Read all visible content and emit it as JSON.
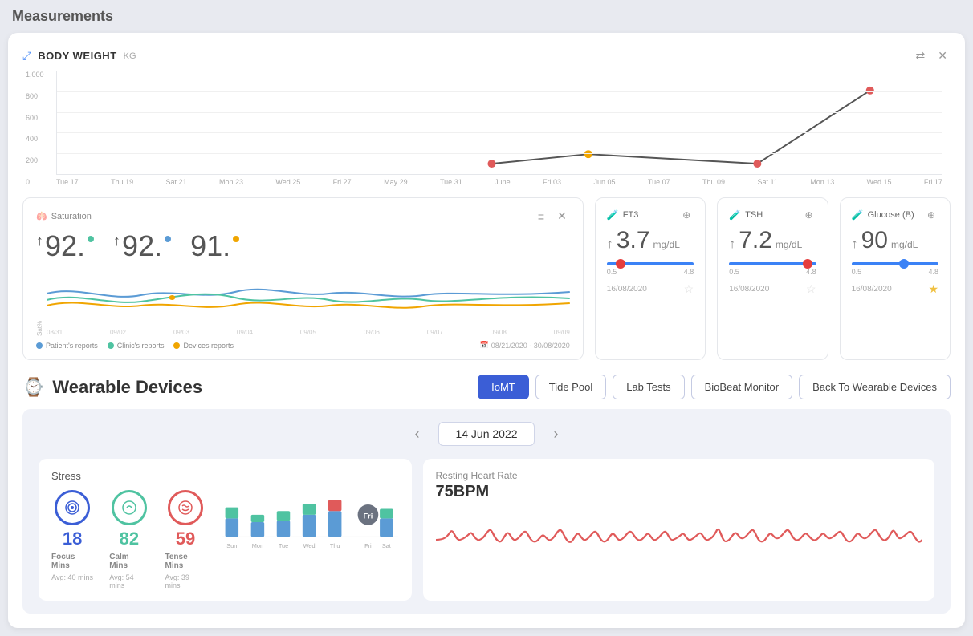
{
  "page": {
    "title": "Measurements"
  },
  "bodyWeight": {
    "title": "BODY WEIGHT",
    "unit": "KG",
    "yLabels": [
      "1,000",
      "800",
      "600",
      "400",
      "200",
      "0"
    ],
    "xLabels": [
      "Tue 17",
      "Thu 19",
      "Sat 21",
      "Mon 23",
      "Wed 25",
      "Fri 27",
      "May 29",
      "Tue 31",
      "June",
      "Fri 03",
      "Jun 05",
      "Tue 07",
      "Thu 09",
      "Sat 11",
      "Mon 13",
      "Wed 15",
      "Fri 17"
    ]
  },
  "saturation": {
    "title": "Saturation",
    "yLabel": "Sat%",
    "values": [
      "92.",
      "92.",
      "91."
    ],
    "xLabels": [
      "08/31",
      "09/02",
      "09/03",
      "09/04",
      "09/05",
      "09/06",
      "09/07",
      "09/08",
      "09/09"
    ],
    "dateRange": "08/21/2020 - 30/08/2020",
    "legend": [
      {
        "label": "Patient's reports",
        "color": "#5b9bd5"
      },
      {
        "label": "Clinic's reports",
        "color": "#4fc3a1"
      },
      {
        "label": "Devices reports",
        "color": "#f0a500"
      }
    ]
  },
  "labCards": [
    {
      "title": "FT3",
      "icon": "flask",
      "value": "3.7",
      "unit": "mg/dL",
      "rangeMin": "0.5",
      "rangeMax": "4.8",
      "dotPosition": "10",
      "date": "16/08/2020",
      "starred": false
    },
    {
      "title": "TSH",
      "icon": "flask-red",
      "value": "7.2",
      "unit": "mg/dL",
      "rangeMin": "0.5",
      "rangeMax": "4.8",
      "dotPosition": "85",
      "date": "16/08/2020",
      "starred": false
    },
    {
      "title": "Glucose (B)",
      "icon": "flask",
      "value": "90",
      "unit": "mg/dL",
      "rangeMin": "0.5",
      "rangeMax": "4.8",
      "dotPosition": "55",
      "date": "16/08/2020",
      "starred": true
    }
  ],
  "wearable": {
    "title": "Wearable Devices",
    "buttons": [
      "IoMT",
      "Tide Pool",
      "Lab Tests",
      "BioBeat Monitor",
      "Back To Wearable Devices"
    ],
    "activeButton": "IoMT",
    "date": "14 Jun 2022",
    "stress": {
      "title": "Stress",
      "metrics": [
        {
          "label": "Focus Mins",
          "value": "18",
          "avg": "Avg: 40 mins",
          "type": "focus"
        },
        {
          "label": "Calm Mins",
          "value": "82",
          "avg": "Avg: 54 mins",
          "type": "calm"
        },
        {
          "label": "Tense Mins",
          "value": "59",
          "avg": "Avg: 39 mins",
          "type": "tense"
        }
      ],
      "barChart": {
        "days": [
          "Sun",
          "Mon",
          "Tue",
          "Wed",
          "Thu",
          "Fri",
          "Sat"
        ],
        "focusActive": 4
      }
    },
    "heartRate": {
      "title": "Resting Heart Rate",
      "value": "75BPM"
    }
  }
}
